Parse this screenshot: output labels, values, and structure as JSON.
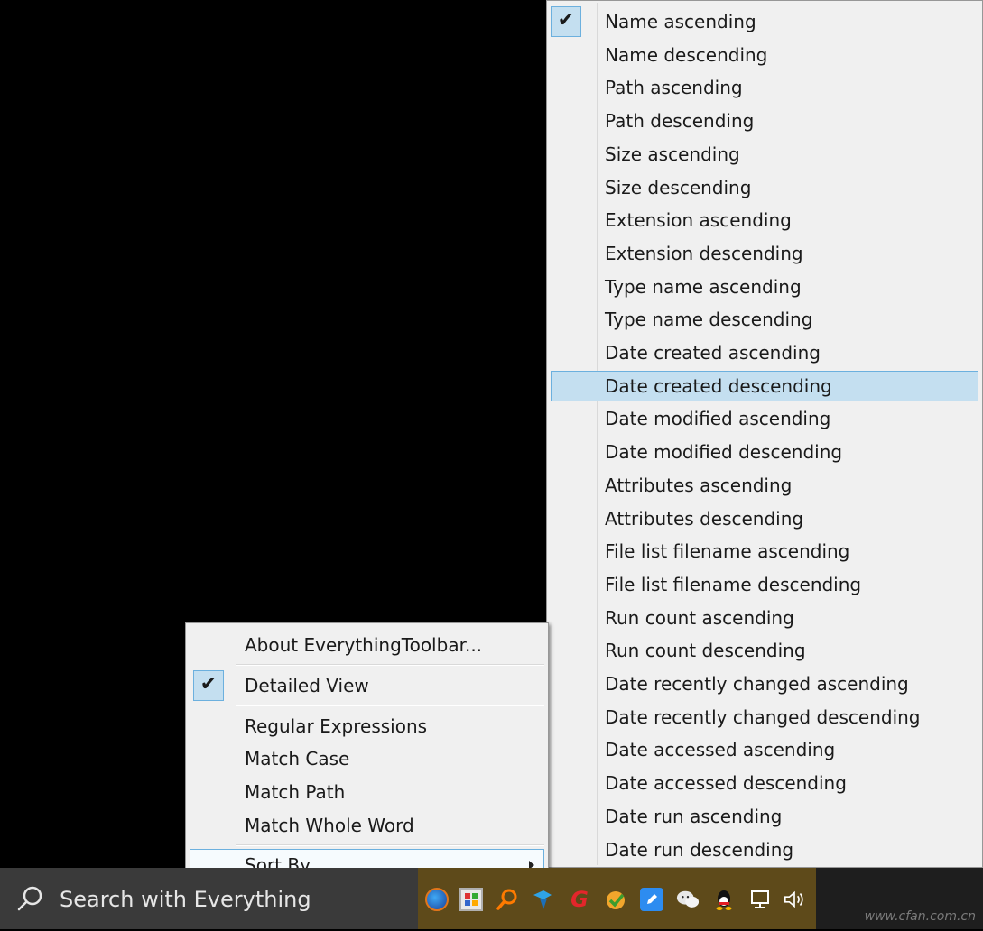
{
  "sort_submenu": {
    "items": [
      {
        "label": "Name ascending",
        "checked": true
      },
      {
        "label": "Name descending"
      },
      {
        "label": "Path ascending"
      },
      {
        "label": "Path descending"
      },
      {
        "label": "Size ascending"
      },
      {
        "label": "Size descending"
      },
      {
        "label": "Extension ascending"
      },
      {
        "label": "Extension descending"
      },
      {
        "label": "Type name ascending"
      },
      {
        "label": "Type name descending"
      },
      {
        "label": "Date created ascending"
      },
      {
        "label": "Date created descending",
        "highlighted": true
      },
      {
        "label": "Date modified ascending"
      },
      {
        "label": "Date modified descending"
      },
      {
        "label": "Attributes ascending"
      },
      {
        "label": "Attributes descending"
      },
      {
        "label": "File list filename ascending"
      },
      {
        "label": "File list filename descending"
      },
      {
        "label": "Run count ascending"
      },
      {
        "label": "Run count descending"
      },
      {
        "label": "Date recently changed ascending"
      },
      {
        "label": "Date recently changed descending"
      },
      {
        "label": "Date accessed ascending"
      },
      {
        "label": "Date accessed descending"
      },
      {
        "label": "Date run ascending"
      },
      {
        "label": "Date run descending"
      }
    ],
    "check_glyph": "✔"
  },
  "context_menu": {
    "about": "About EverythingToolbar...",
    "detailed_view": "Detailed View",
    "detailed_view_checked": true,
    "regex": "Regular Expressions",
    "match_case": "Match Case",
    "match_path": "Match Path",
    "match_whole_word": "Match Whole Word",
    "sort_by": "Sort By..."
  },
  "taskbar": {
    "search_placeholder": "Search with Everything",
    "tray_icons": [
      "firefox-icon",
      "app-grid-icon",
      "search-app-icon",
      "pin-icon",
      "g-app-icon",
      "check-shield-icon",
      "notes-icon",
      "wechat-icon",
      "qq-icon",
      "network-icon",
      "volume-icon"
    ]
  },
  "watermark": "www.cfan.com.cn",
  "colors": {
    "menu_bg": "#f0f0f0",
    "highlight_bg": "#c4dff0",
    "highlight_border": "#6cb0de",
    "taskbar_bg": "#1e1e1e",
    "search_bg": "#3a3a3a",
    "tray_bg": "#5e4a1a"
  }
}
